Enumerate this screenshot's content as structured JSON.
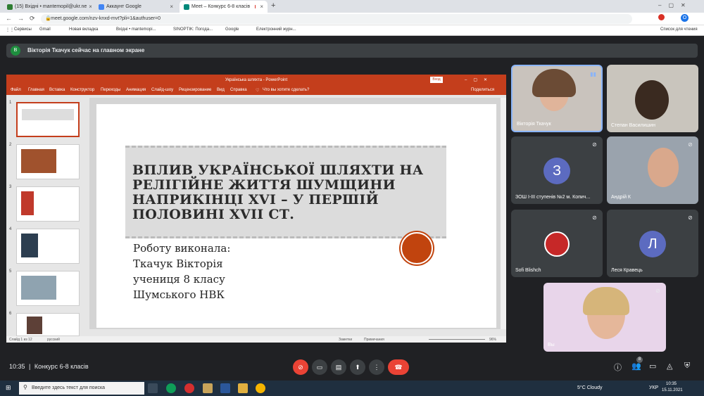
{
  "browser": {
    "tabs": [
      {
        "label": "(15) Вхідні • mantemopil@ukr.ne",
        "color": "#2e7d32"
      },
      {
        "label": "Аккаунт Google",
        "color": "#4285f4"
      },
      {
        "label": "Meet – Конкурс 6-8 класів",
        "color": "#00897b"
      }
    ],
    "url": "meet.google.com/nzv-knxd-mvt?pli=1&authuser=0",
    "bookmarks": [
      "Сервисы",
      "Gmail",
      "Новая вкладка",
      "Вхідні • mantemopi...",
      "SINOPTIK: Погода...",
      "Google",
      "Електронний журн..."
    ],
    "reading_list": "Список для чтения"
  },
  "meet": {
    "banner": "Вікторія Ткачук сейчас на главном экране",
    "banner_initial": "В",
    "time": "10:35",
    "meeting_name": "Конкурс 6-8 класів",
    "people_count": "8",
    "participants": [
      {
        "name": "Вікторія Ткачук",
        "type": "video"
      },
      {
        "name": "Степан Василишин",
        "type": "video"
      },
      {
        "name": "ЗОШ I-III ступенів №2 м. Копич...",
        "type": "avatar",
        "initial": "З",
        "color": "#5c6bc0"
      },
      {
        "name": "Андрій К",
        "type": "video"
      },
      {
        "name": "Sofi Blishch",
        "type": "avatar"
      },
      {
        "name": "Леся Кравець",
        "type": "avatar",
        "initial": "Л",
        "color": "#5c6bc0"
      },
      {
        "name": "Вы",
        "type": "video"
      }
    ]
  },
  "ppt": {
    "title": "Українська шляхта - PowerPoint",
    "login": "Вход",
    "ribbon": [
      "Файл",
      "Главная",
      "Вставка",
      "Конструктор",
      "Переходы",
      "Анимация",
      "Слайд-шоу",
      "Рецензирование",
      "Вид",
      "Справка"
    ],
    "tell_me": "Что вы хотите сделать?",
    "share": "Поделиться",
    "thumb_numbers": [
      "1",
      "2",
      "3",
      "4",
      "5",
      "6"
    ],
    "slide_title": "ВПЛИВ УКРАЇНСЬКОЇ ШЛЯХТИ НА РЕЛІГІЙНЕ ЖИТТЯ ШУМЩИНИ НАПРИКІНЦІ XVI – У ПЕРШІЙ ПОЛОВИНІ XVII СТ.",
    "subtitle_lines": [
      "Роботу виконала:",
      "Ткачук Вікторія",
      "учениця 8 класу",
      "Шумського НВК"
    ],
    "status_left": "Слайд 1 из 12",
    "status_lang": "русский",
    "notes": "Заметки",
    "comments": "Примечания",
    "zoom": "96%"
  },
  "taskbar": {
    "search_placeholder": "Введите здесь текст для поиска",
    "weather": "5°C  Cloudy",
    "lang": "УКР",
    "clock_time": "10:35",
    "clock_date": "15.11.2021"
  }
}
